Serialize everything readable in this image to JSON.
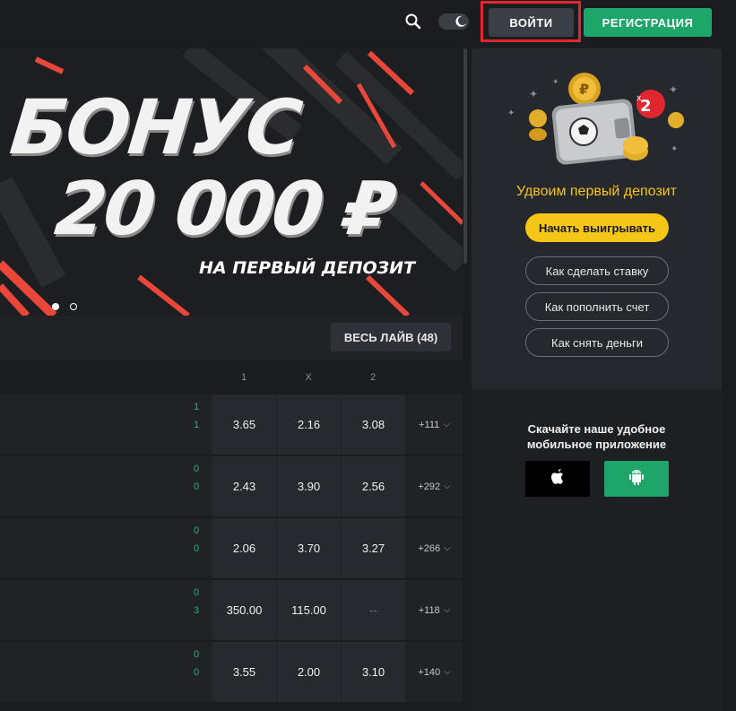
{
  "header": {
    "search_icon": "search-icon",
    "theme_icon": "moon-icon",
    "login_label": "ВОЙТИ",
    "register_label": "РЕГИСТРАЦИЯ"
  },
  "banner": {
    "title": "БОНУС",
    "amount": "20 000 ₽",
    "subtitle": "НА ПЕРВЫЙ ДЕПОЗИТ",
    "slides_total": 2,
    "active_slide": 1
  },
  "live": {
    "all_label": "ВЕСЬ ЛАЙВ (48)",
    "columns": [
      "1",
      "X",
      "2"
    ]
  },
  "matches": [
    {
      "score_home": "1",
      "score_away": "1",
      "odd_1": "3.65",
      "odd_x": "2.16",
      "odd_2": "3.08",
      "more": "+111"
    },
    {
      "score_home": "0",
      "score_away": "0",
      "odd_1": "2.43",
      "odd_x": "3.90",
      "odd_2": "2.56",
      "more": "+292"
    },
    {
      "score_home": "0",
      "score_away": "0",
      "odd_1": "2.06",
      "odd_x": "3.70",
      "odd_2": "3.27",
      "more": "+266"
    },
    {
      "score_home": "0",
      "score_away": "3",
      "odd_1": "350.00",
      "odd_x": "115.00",
      "odd_2": "--",
      "more": "+118"
    },
    {
      "score_home": "0",
      "score_away": "0",
      "odd_1": "3.55",
      "odd_x": "2.00",
      "odd_2": "3.10",
      "more": "+140"
    }
  ],
  "sidebar": {
    "badge": "x2",
    "promo_text": "Удвоим первый депозит",
    "start_label": "Начать выигрывать",
    "how_bet_label": "Как сделать ставку",
    "how_deposit_label": "Как пополнить счет",
    "how_withdraw_label": "Как снять деньги",
    "app_text_line1": "Скачайте наше удобное",
    "app_text_line2": "мобильное приложение",
    "apple_icon": "apple-icon",
    "android_icon": "android-icon"
  },
  "colors": {
    "accent_green": "#1ea66a",
    "accent_yellow": "#f5c518",
    "highlight_red": "#e0262f",
    "score_green": "#21b573"
  }
}
